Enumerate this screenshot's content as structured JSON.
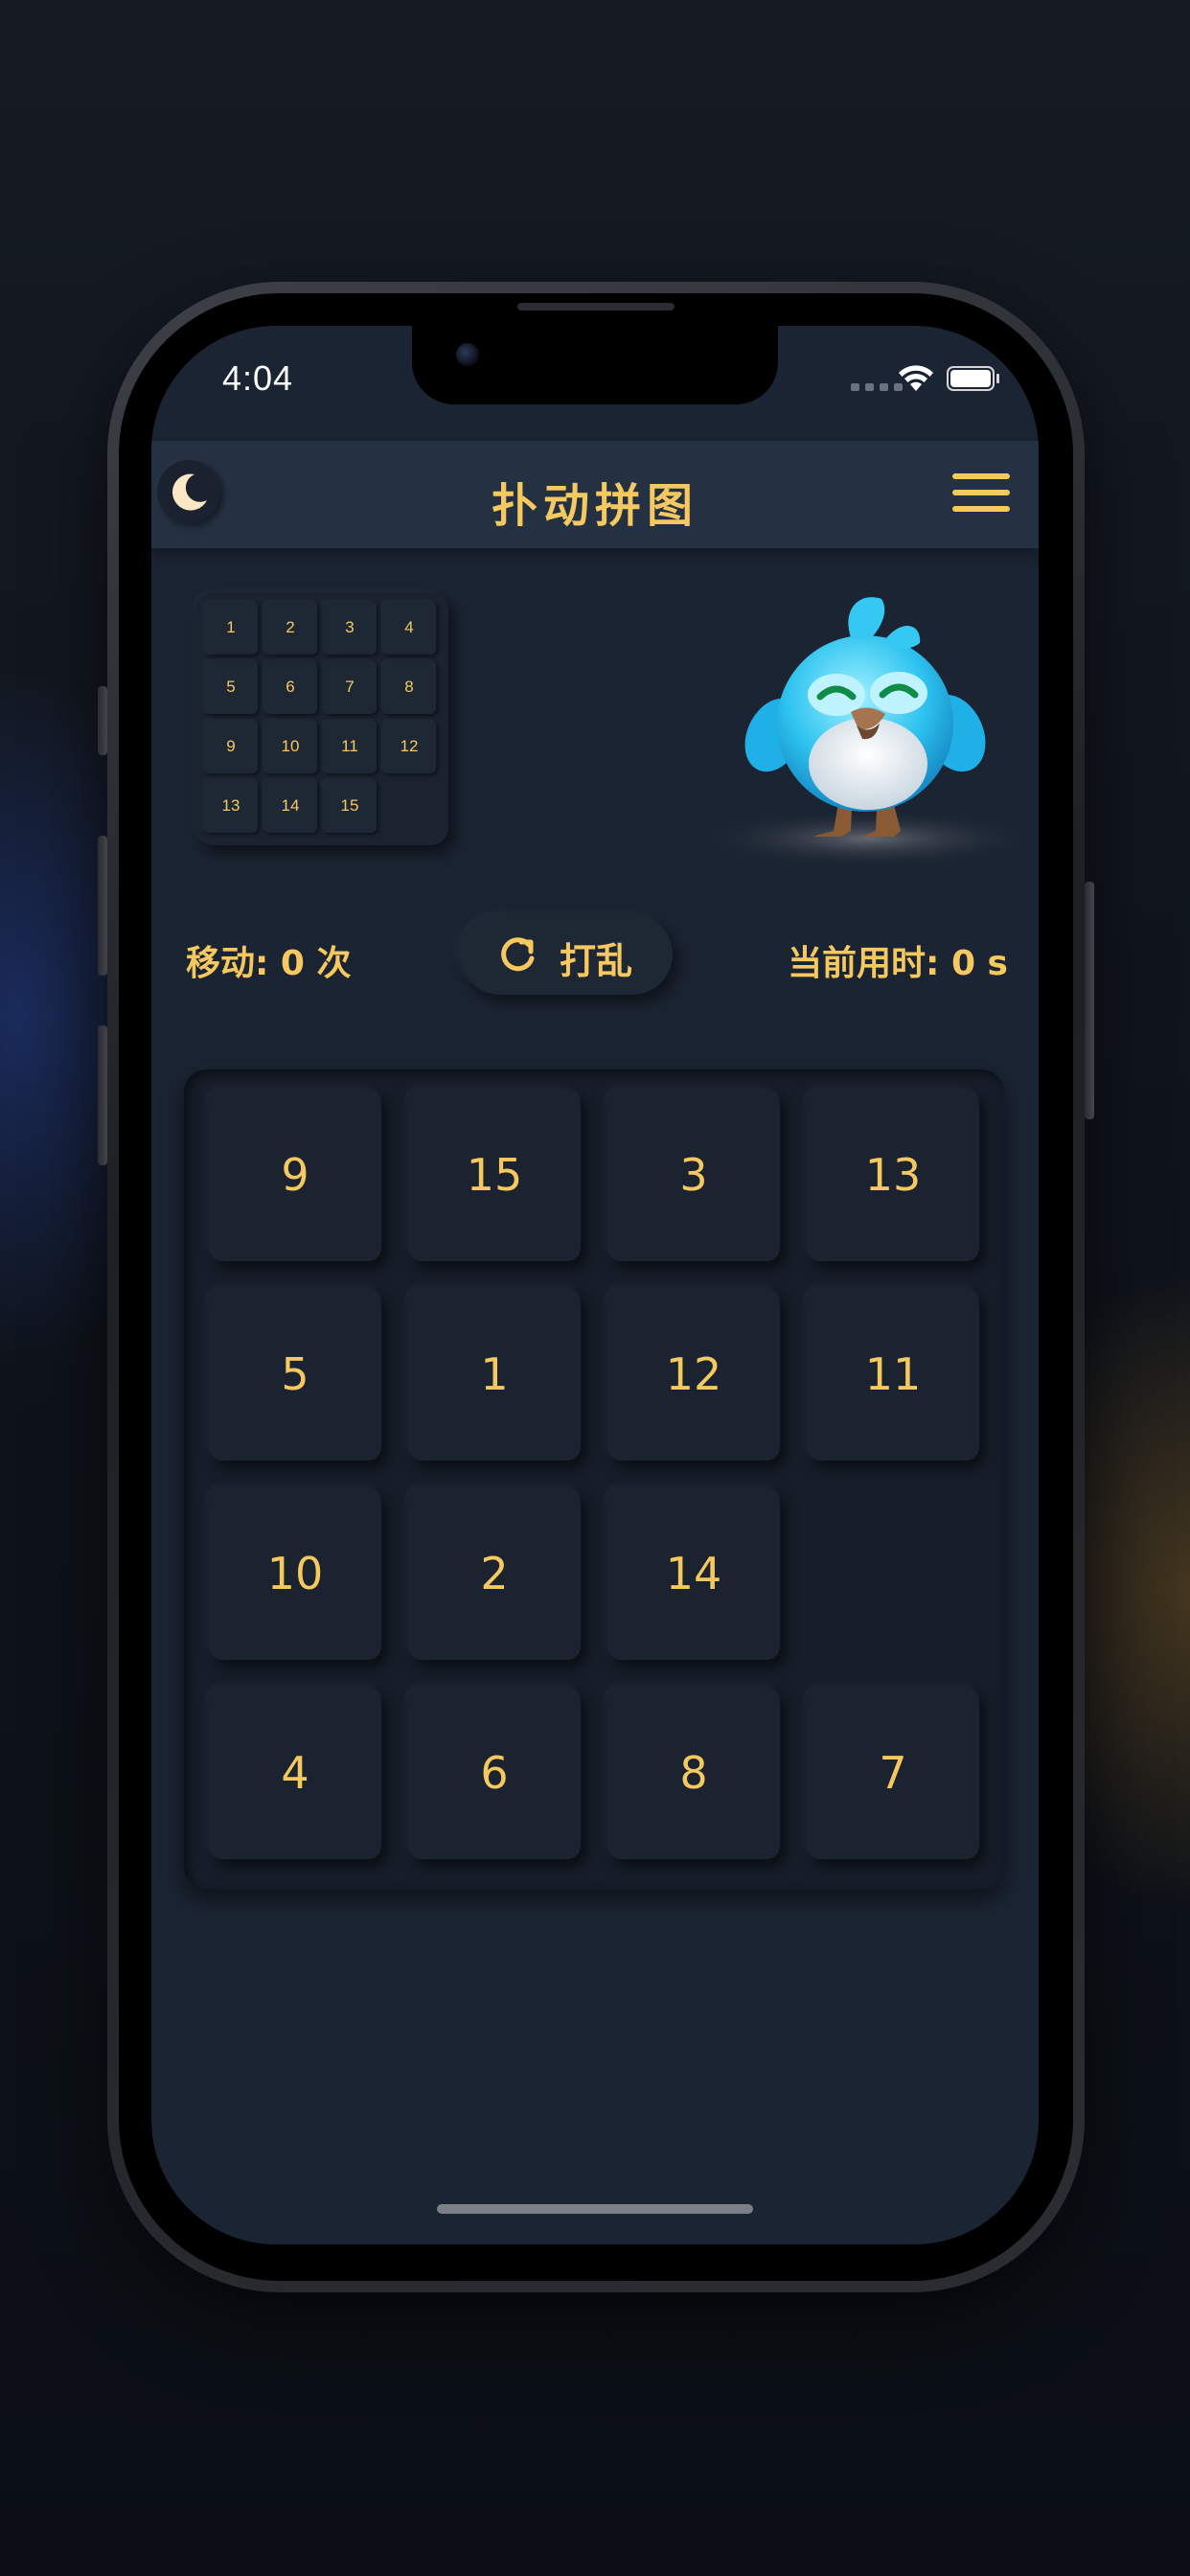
{
  "status_bar": {
    "time": "4:04"
  },
  "header": {
    "title": "扑动拼图",
    "theme_icon": "moon-icon",
    "menu_icon": "hamburger-menu-icon"
  },
  "preview": {
    "tiles": [
      "1",
      "2",
      "3",
      "4",
      "5",
      "6",
      "7",
      "8",
      "9",
      "10",
      "11",
      "12",
      "13",
      "14",
      "15",
      ""
    ]
  },
  "stats": {
    "moves_text": "移动: 0 次",
    "timer_text": "当前用时: 0 s"
  },
  "shuffle": {
    "label": "打乱",
    "icon": "refresh-icon"
  },
  "board": {
    "tiles": [
      "9",
      "15",
      "3",
      "13",
      "5",
      "1",
      "12",
      "11",
      "10",
      "2",
      "14",
      "",
      "4",
      "6",
      "8",
      "7"
    ]
  },
  "colors": {
    "accent": "#f6c860",
    "background": "#1b2432",
    "header": "#243142"
  }
}
